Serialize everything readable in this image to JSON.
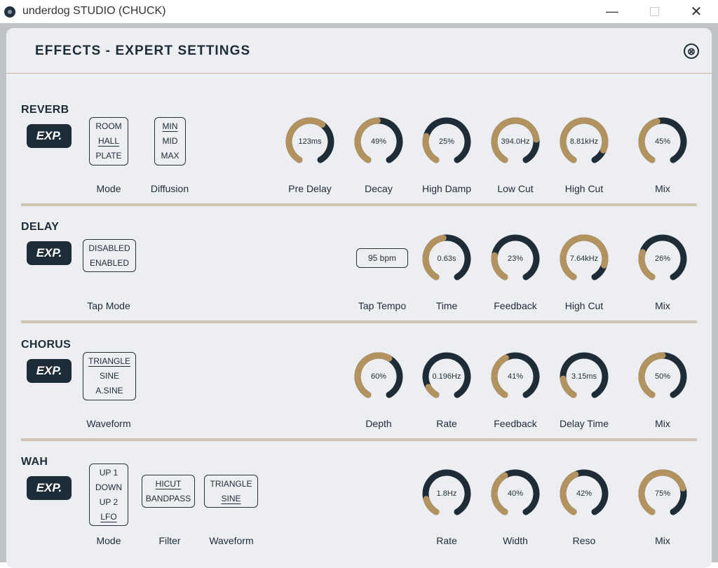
{
  "window": {
    "title": "underdog STUDIO (CHUCK)",
    "minimize": "—",
    "close": "✕"
  },
  "colors": {
    "dark": "#1e2c38",
    "accent": "#b2935f",
    "panel": "#eceef1",
    "separator": "#cfc5b3"
  },
  "panel": {
    "title": "EFFECTS - EXPERT SETTINGS",
    "close_icon": "⊗"
  },
  "sections": {
    "reverb": {
      "title": "REVERB",
      "exp": "EXP.",
      "mode": {
        "options": [
          "ROOM",
          "HALL",
          "PLATE"
        ],
        "selected": "HALL",
        "label": "Mode"
      },
      "diffusion": {
        "options": [
          "MIN",
          "MID",
          "MAX"
        ],
        "selected": "MIN",
        "label": "Diffusion"
      },
      "knobs": [
        {
          "label": "Pre Delay",
          "value": "123ms",
          "level": 0.62
        },
        {
          "label": "Decay",
          "value": "49%",
          "level": 0.49
        },
        {
          "label": "High Damp",
          "value": "25%",
          "level": 0.25
        },
        {
          "label": "Low Cut",
          "value": "394.0Hz",
          "level": 0.78
        },
        {
          "label": "High Cut",
          "value": "8.81kHz",
          "level": 0.88
        },
        {
          "label": "Mix",
          "value": "45%",
          "level": 0.45
        }
      ]
    },
    "delay": {
      "title": "DELAY",
      "exp": "EXP.",
      "tap_mode": {
        "options": [
          "DISABLED",
          "ENABLED"
        ],
        "selected": "",
        "label": "Tap Mode"
      },
      "tap_tempo": {
        "value": "95 bpm",
        "label": "Tap Tempo"
      },
      "knobs": [
        {
          "label": "Time",
          "value": "0.63s",
          "level": 0.47
        },
        {
          "label": "Feedback",
          "value": "23%",
          "level": 0.23
        },
        {
          "label": "High Cut",
          "value": "7.64kHz",
          "level": 0.86
        },
        {
          "label": "Mix",
          "value": "26%",
          "level": 0.26
        }
      ]
    },
    "chorus": {
      "title": "CHORUS",
      "exp": "EXP.",
      "waveform": {
        "options": [
          "TRIANGLE",
          "SINE",
          "A.SINE"
        ],
        "selected": "TRIANGLE",
        "label": "Waveform"
      },
      "knobs": [
        {
          "label": "Depth",
          "value": "60%",
          "level": 0.6
        },
        {
          "label": "Rate",
          "value": "0.196Hz",
          "level": 0.1
        },
        {
          "label": "Feedback",
          "value": "41%",
          "level": 0.41
        },
        {
          "label": "Delay Time",
          "value": "3.15ms",
          "level": 0.18
        },
        {
          "label": "Mix",
          "value": "50%",
          "level": 0.5
        }
      ]
    },
    "wah": {
      "title": "WAH",
      "exp": "EXP.",
      "mode": {
        "options": [
          "UP 1",
          "DOWN",
          "UP 2",
          "LFO"
        ],
        "selected": "LFO",
        "label": "Mode"
      },
      "filter": {
        "options": [
          "HICUT",
          "BANDPASS"
        ],
        "selected": "HICUT",
        "label": "Filter"
      },
      "waveform": {
        "options": [
          "TRIANGLE",
          "SINE"
        ],
        "selected": "SINE",
        "label": "Waveform"
      },
      "knobs": [
        {
          "label": "Rate",
          "value": "1.8Hz",
          "level": 0.15
        },
        {
          "label": "Width",
          "value": "40%",
          "level": 0.4
        },
        {
          "label": "Reso",
          "value": "42%",
          "level": 0.42
        },
        {
          "label": "Mix",
          "value": "75%",
          "level": 0.75
        }
      ]
    }
  }
}
